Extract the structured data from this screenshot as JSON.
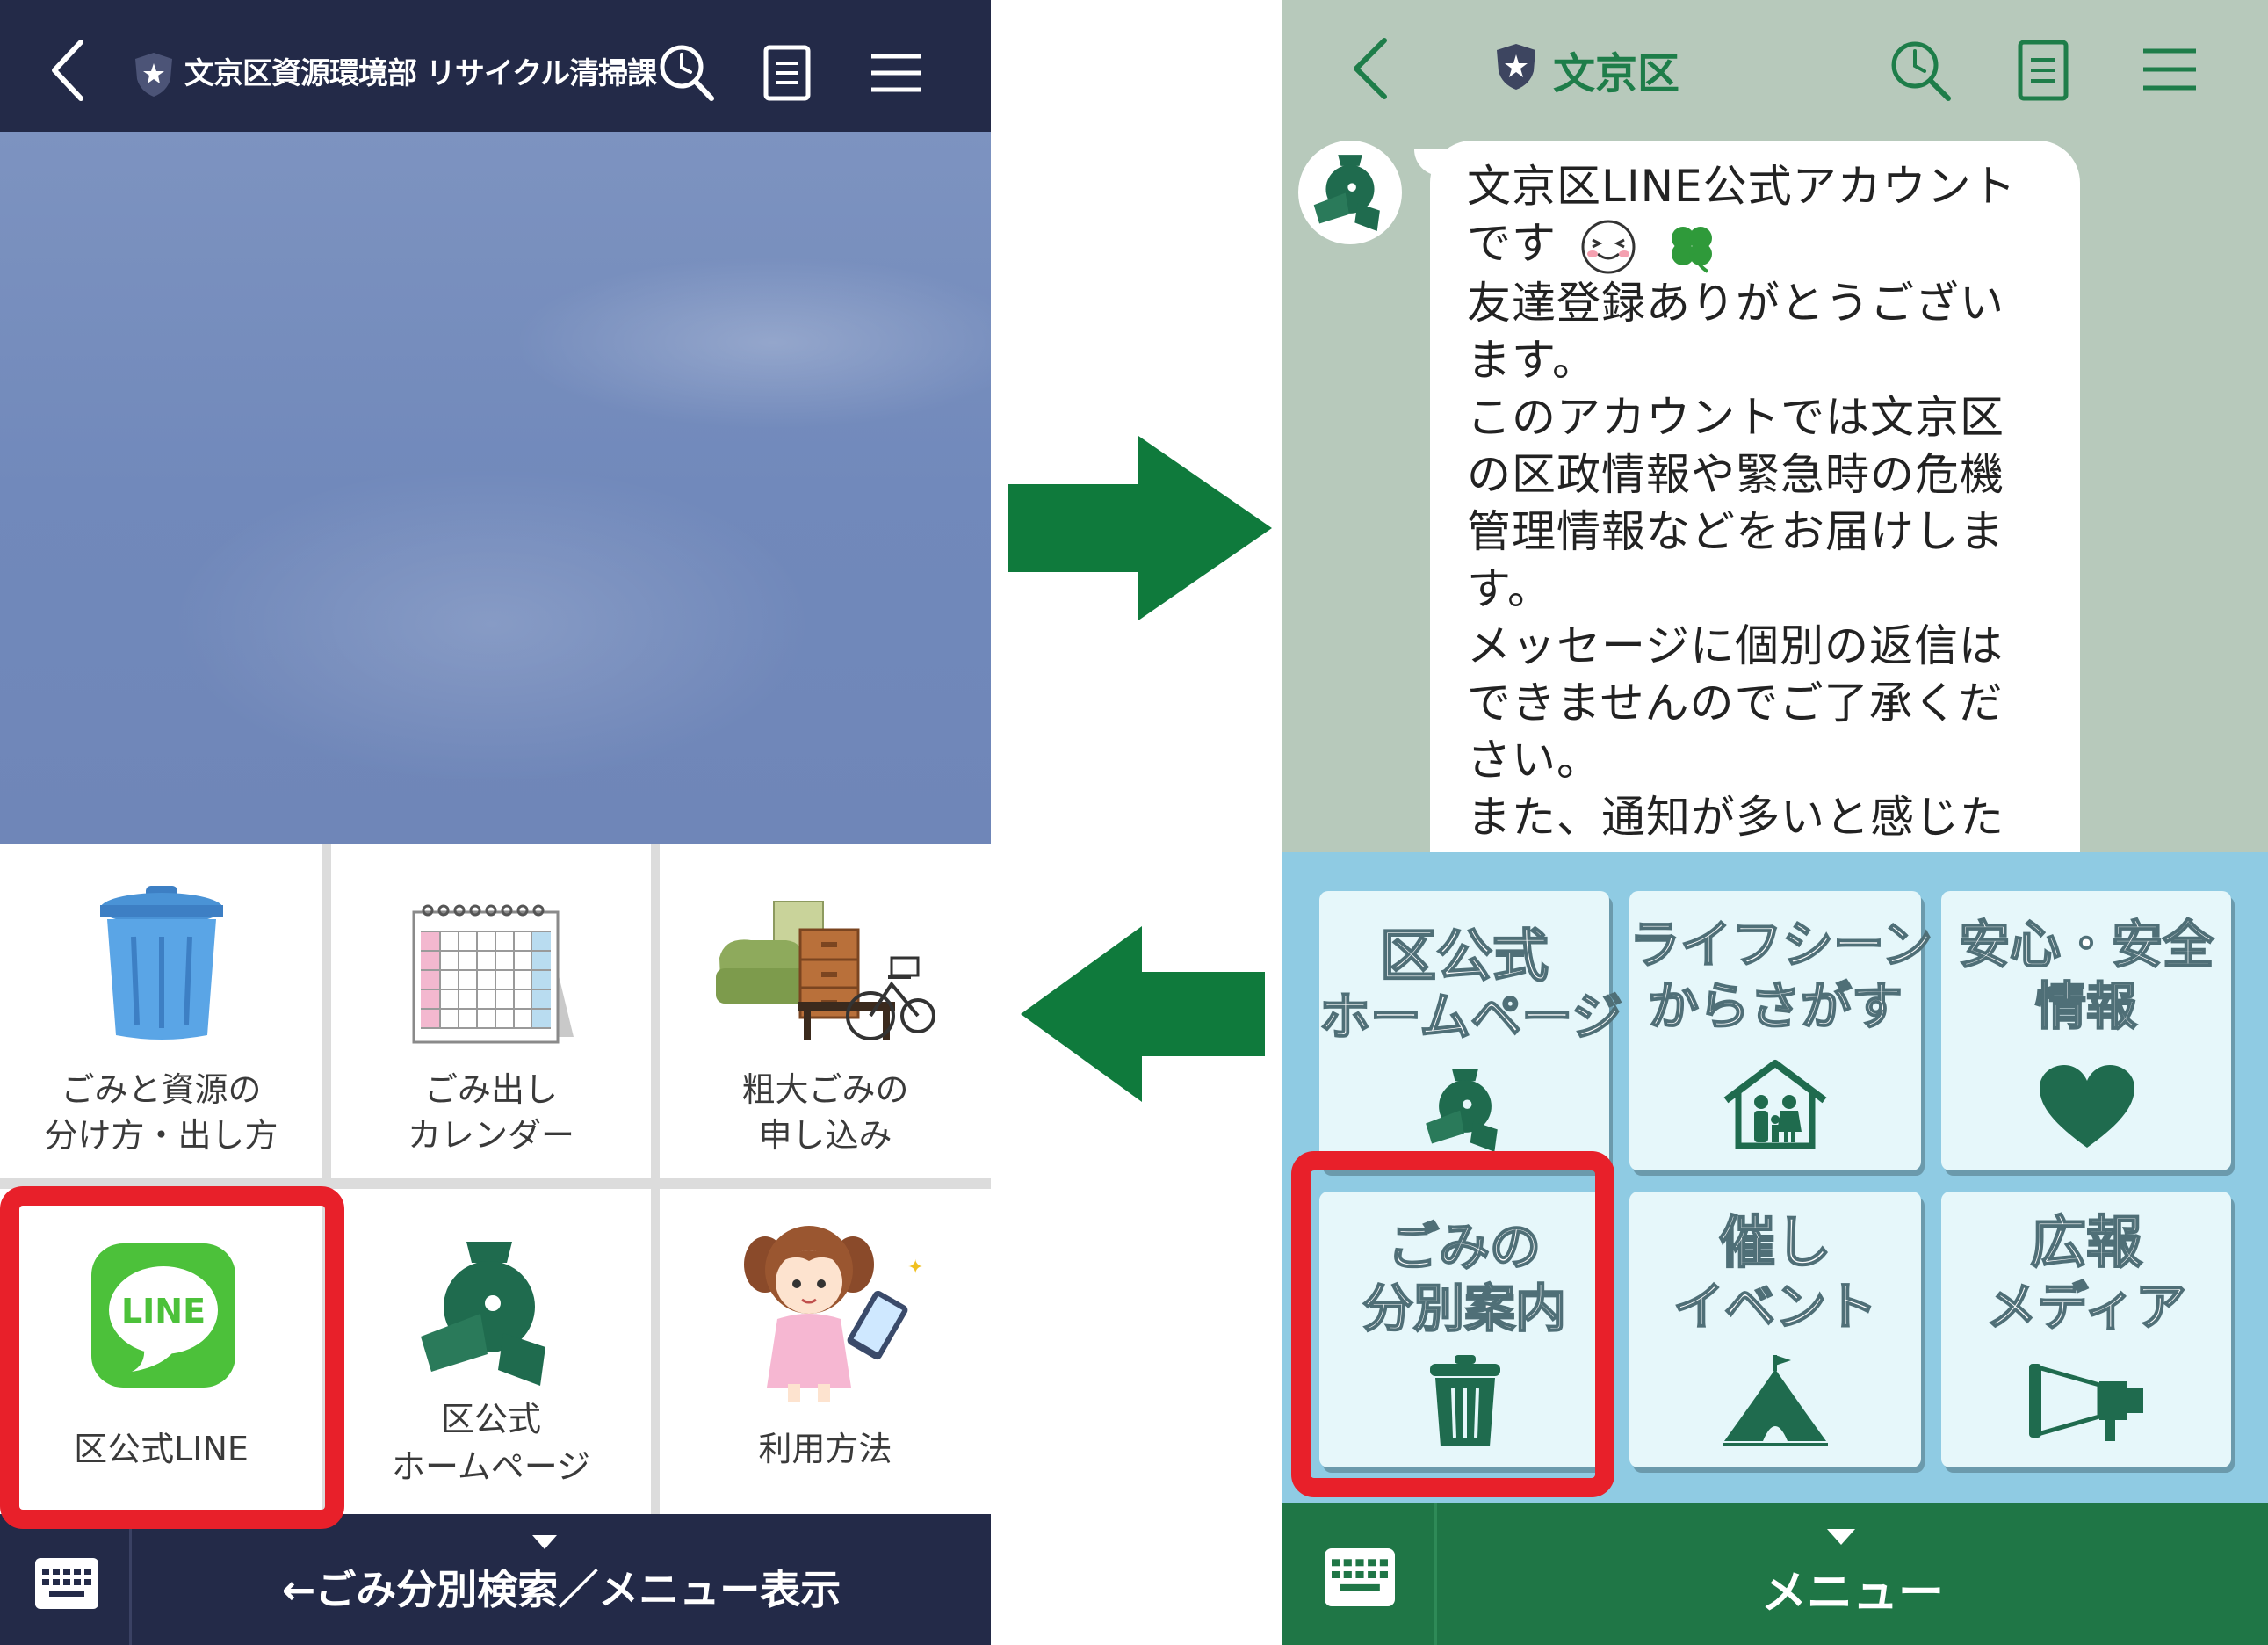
{
  "left": {
    "header": {
      "title": "文京区資源環境部 リサイクル清掃課"
    },
    "menu_items": [
      {
        "id": "sort",
        "label_line1": "ごみと資源の",
        "label_line2": "分け方・出し方"
      },
      {
        "id": "calendar",
        "label_line1": "ごみ出し",
        "label_line2": "カレンダー"
      },
      {
        "id": "bulky",
        "label_line1": "粗大ごみの",
        "label_line2": "申し込み"
      },
      {
        "id": "line",
        "label_line1": "区公式LINE",
        "icon_text": "LINE"
      },
      {
        "id": "homepage",
        "label_line1": "区公式",
        "label_line2": "ホームページ"
      },
      {
        "id": "howto",
        "label_line1": "利用方法"
      }
    ],
    "footer": {
      "label": "←ごみ分別検索／メニュー表示"
    }
  },
  "right": {
    "header": {
      "title": "文京区"
    },
    "message_lines": [
      "文京区LINE公式アカウント",
      "です",
      "友達登録ありがとうござい",
      "ます。",
      "このアカウントでは文京区",
      "の区政情報や緊急時の危機",
      "管理情報などをお届けしま",
      "す。",
      "メッセージに個別の返信は",
      "できませんのでご了承くだ",
      "さい。",
      "また、通知が多いと感じた"
    ],
    "menu_tiles": [
      {
        "id": "homepage",
        "line1": "区公式",
        "line2": "ホームページ"
      },
      {
        "id": "lifescene",
        "line1": "ライフシーン",
        "line2": "からさがす"
      },
      {
        "id": "safety",
        "line1": "安心・安全",
        "line2": "情報"
      },
      {
        "id": "garbage",
        "line1": "ごみの",
        "line2": "分別案内"
      },
      {
        "id": "events",
        "line1": "催し",
        "line2": "イベント"
      },
      {
        "id": "media",
        "line1": "広報",
        "line2": "メディア"
      }
    ],
    "footer": {
      "label": "メニュー"
    }
  },
  "colors": {
    "left_header": "#232a48",
    "right_header": "#b7c9bb",
    "accent_green": "#1e7d49",
    "arrow_green": "#0f7a3c",
    "highlight_red": "#e8202a",
    "right_menu_bg": "#8fcbe3"
  }
}
